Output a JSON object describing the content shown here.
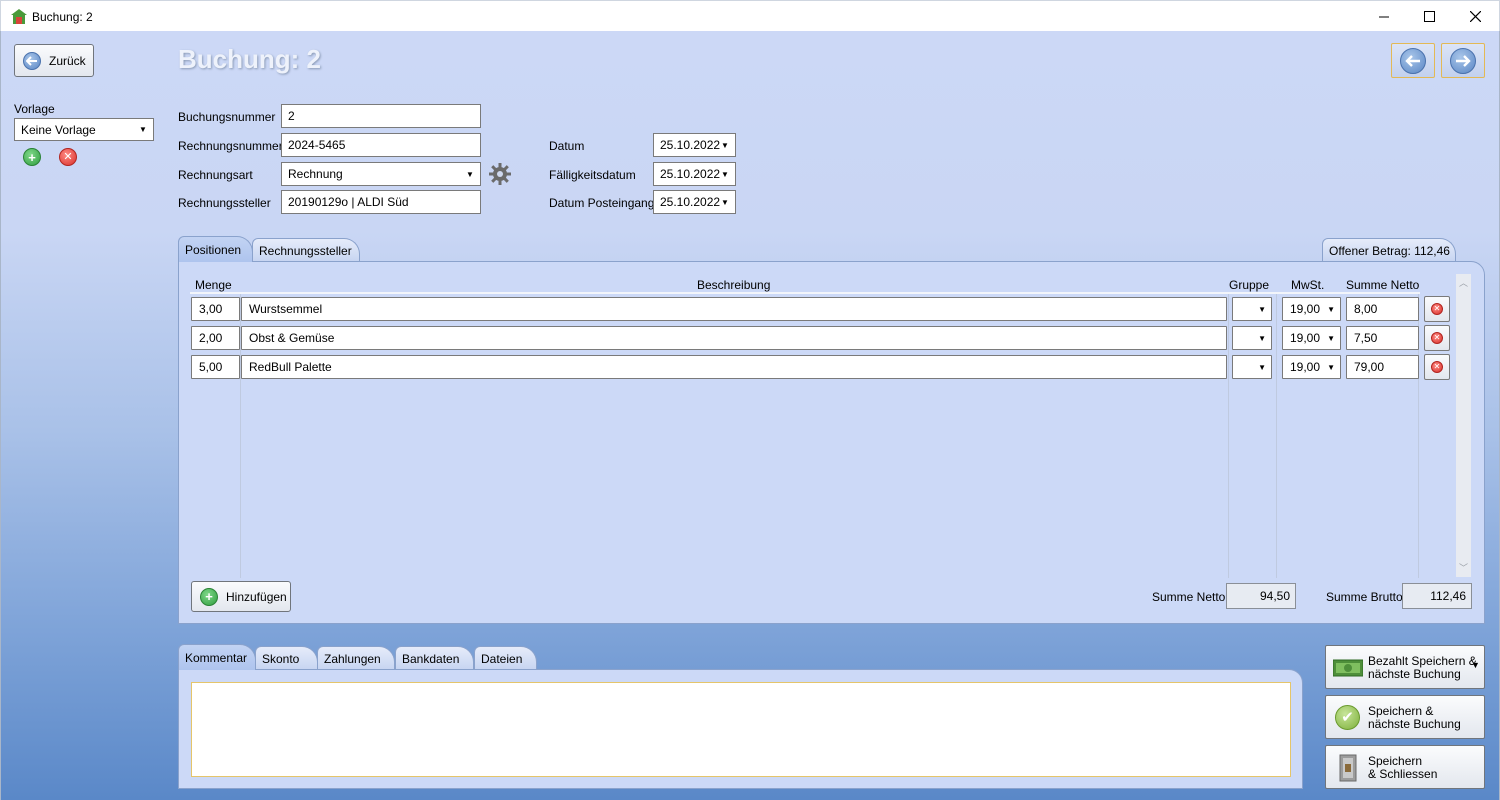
{
  "window": {
    "title": "Buchung: 2",
    "minimize": "—",
    "maximize": "☐",
    "close": "✕"
  },
  "header": {
    "back_label": "Zurück",
    "page_title": "Buchung: 2"
  },
  "vorlage": {
    "label": "Vorlage",
    "value": "Keine Vorlage"
  },
  "form": {
    "buchungsnummer_label": "Buchungsnummer",
    "buchungsnummer": "2",
    "rechnungsnummer_label": "Rechnungsnummer",
    "rechnungsnummer": "2024-5465",
    "rechnungsart_label": "Rechnungsart",
    "rechnungsart": "Rechnung",
    "rechnungssteller_label": "Rechnungssteller",
    "rechnungssteller": "20190129o | ALDI Süd",
    "datum_label": "Datum",
    "datum": "25.10.2022",
    "faelligkeit_label": "Fälligkeitsdatum",
    "faelligkeit": "25.10.2022",
    "posteingang_label": "Datum Posteingang",
    "posteingang": "25.10.2022"
  },
  "top_tabs": {
    "positionen": "Positionen",
    "rechnungssteller": "Rechnungssteller",
    "offener_betrag": "Offener Betrag: 112,46"
  },
  "positions": {
    "headers": {
      "menge": "Menge",
      "beschreibung": "Beschreibung",
      "gruppe": "Gruppe",
      "mwst": "MwSt.",
      "summe_netto": "Summe Netto"
    },
    "rows": [
      {
        "menge": "3,00",
        "beschreibung": "Wurstsemmel",
        "gruppe": "",
        "mwst": "19,00",
        "summe": "8,00"
      },
      {
        "menge": "2,00",
        "beschreibung": "Obst & Gemüse",
        "gruppe": "",
        "mwst": "19,00",
        "summe": "7,50"
      },
      {
        "menge": "5,00",
        "beschreibung": "RedBull Palette",
        "gruppe": "",
        "mwst": "19,00",
        "summe": "79,00"
      }
    ],
    "add_label": "Hinzufügen",
    "summe_netto_label": "Summe Netto",
    "summe_netto": "94,50",
    "summe_brutto_label": "Summe Brutto",
    "summe_brutto": "112,46"
  },
  "bottom_tabs": {
    "kommentar": "Kommentar",
    "skonto": "Skonto",
    "zahlungen": "Zahlungen",
    "bankdaten": "Bankdaten",
    "dateien": "Dateien"
  },
  "comment": {
    "value": ""
  },
  "actions": {
    "bezahlt_1": "Bezahlt Speichern &",
    "bezahlt_2": "nächste Buchung",
    "speichern_naechste_1": "Speichern &",
    "speichern_naechste_2": "nächste Buchung",
    "speichern_schliessen_1": "Speichern",
    "speichern_schliessen_2": "& Schliessen"
  },
  "icons": {
    "back": "arrow-left-icon",
    "forward": "arrow-right-icon",
    "add": "plus-icon",
    "remove": "close-icon",
    "settings": "gear-icon",
    "dropdown": "chevron-down-icon"
  }
}
